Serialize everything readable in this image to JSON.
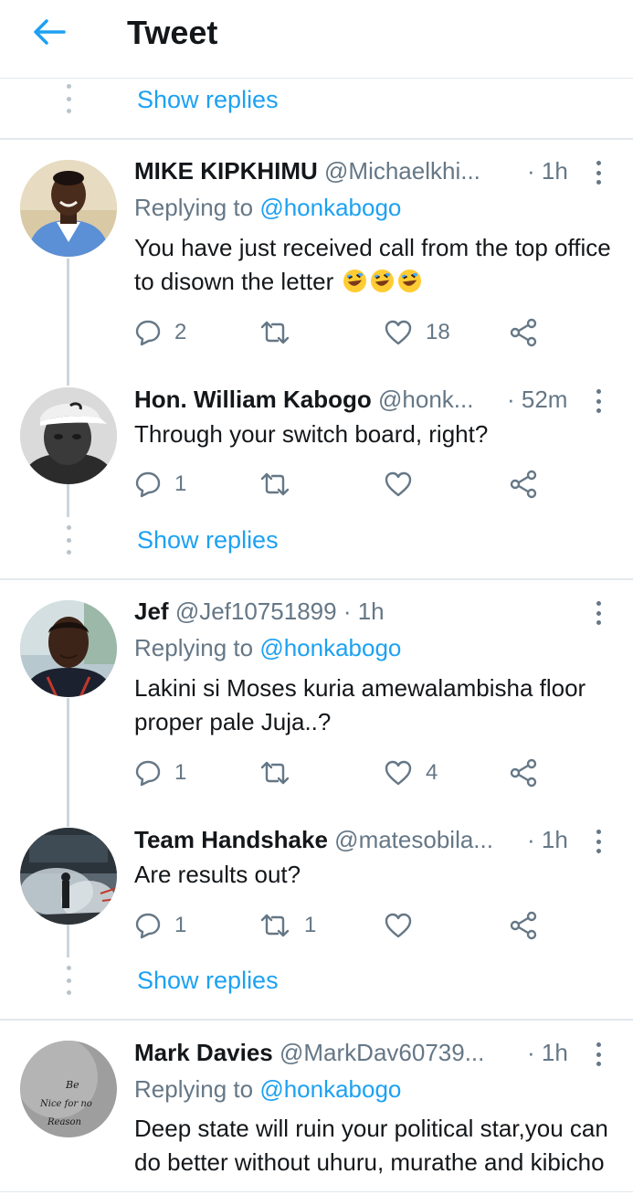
{
  "header": {
    "title": "Tweet",
    "back_icon": "back-arrow-icon",
    "accent": "#1da1f2"
  },
  "show_replies_label": "Show replies",
  "tweets": [
    {
      "name": "MIKE KIPKHIMU",
      "handle": "@Michaelkhi...",
      "time": "· 1h",
      "replying_prefix": "Replying to",
      "replying_to": "@honkabogo",
      "text": "You have just received call from the top office to disown the letter",
      "emoji": [
        "rofl-emoji",
        "rofl-emoji",
        "rofl-emoji"
      ],
      "replies": "2",
      "retweets": "",
      "likes": "18"
    },
    {
      "name": "Hon. William Kabogo",
      "handle": "@honk...",
      "time": "· 52m",
      "text": "Through your switch board, right?",
      "replies": "1",
      "retweets": "",
      "likes": ""
    },
    {
      "name": "Jef",
      "handle": "@Jef10751899",
      "time": "· 1h",
      "replying_prefix": "Replying to",
      "replying_to": "@honkabogo",
      "text": "Lakini si Moses kuria amewalambisha floor proper pale Juja..?",
      "replies": "1",
      "retweets": "",
      "likes": "4"
    },
    {
      "name": "Team Handshake",
      "handle": "@matesobila...",
      "time": "· 1h",
      "text": "Are results out?",
      "replies": "1",
      "retweets": "1",
      "likes": ""
    },
    {
      "name": "Mark Davies",
      "handle": "@MarkDav60739...",
      "time": "· 1h",
      "replying_prefix": "Replying to",
      "replying_to": "@honkabogo",
      "text": "Deep state will ruin your political star,you can do better without uhuru, murathe and kibicho",
      "avatar_text": [
        "Be",
        "Nice for no",
        "Reason"
      ]
    }
  ]
}
